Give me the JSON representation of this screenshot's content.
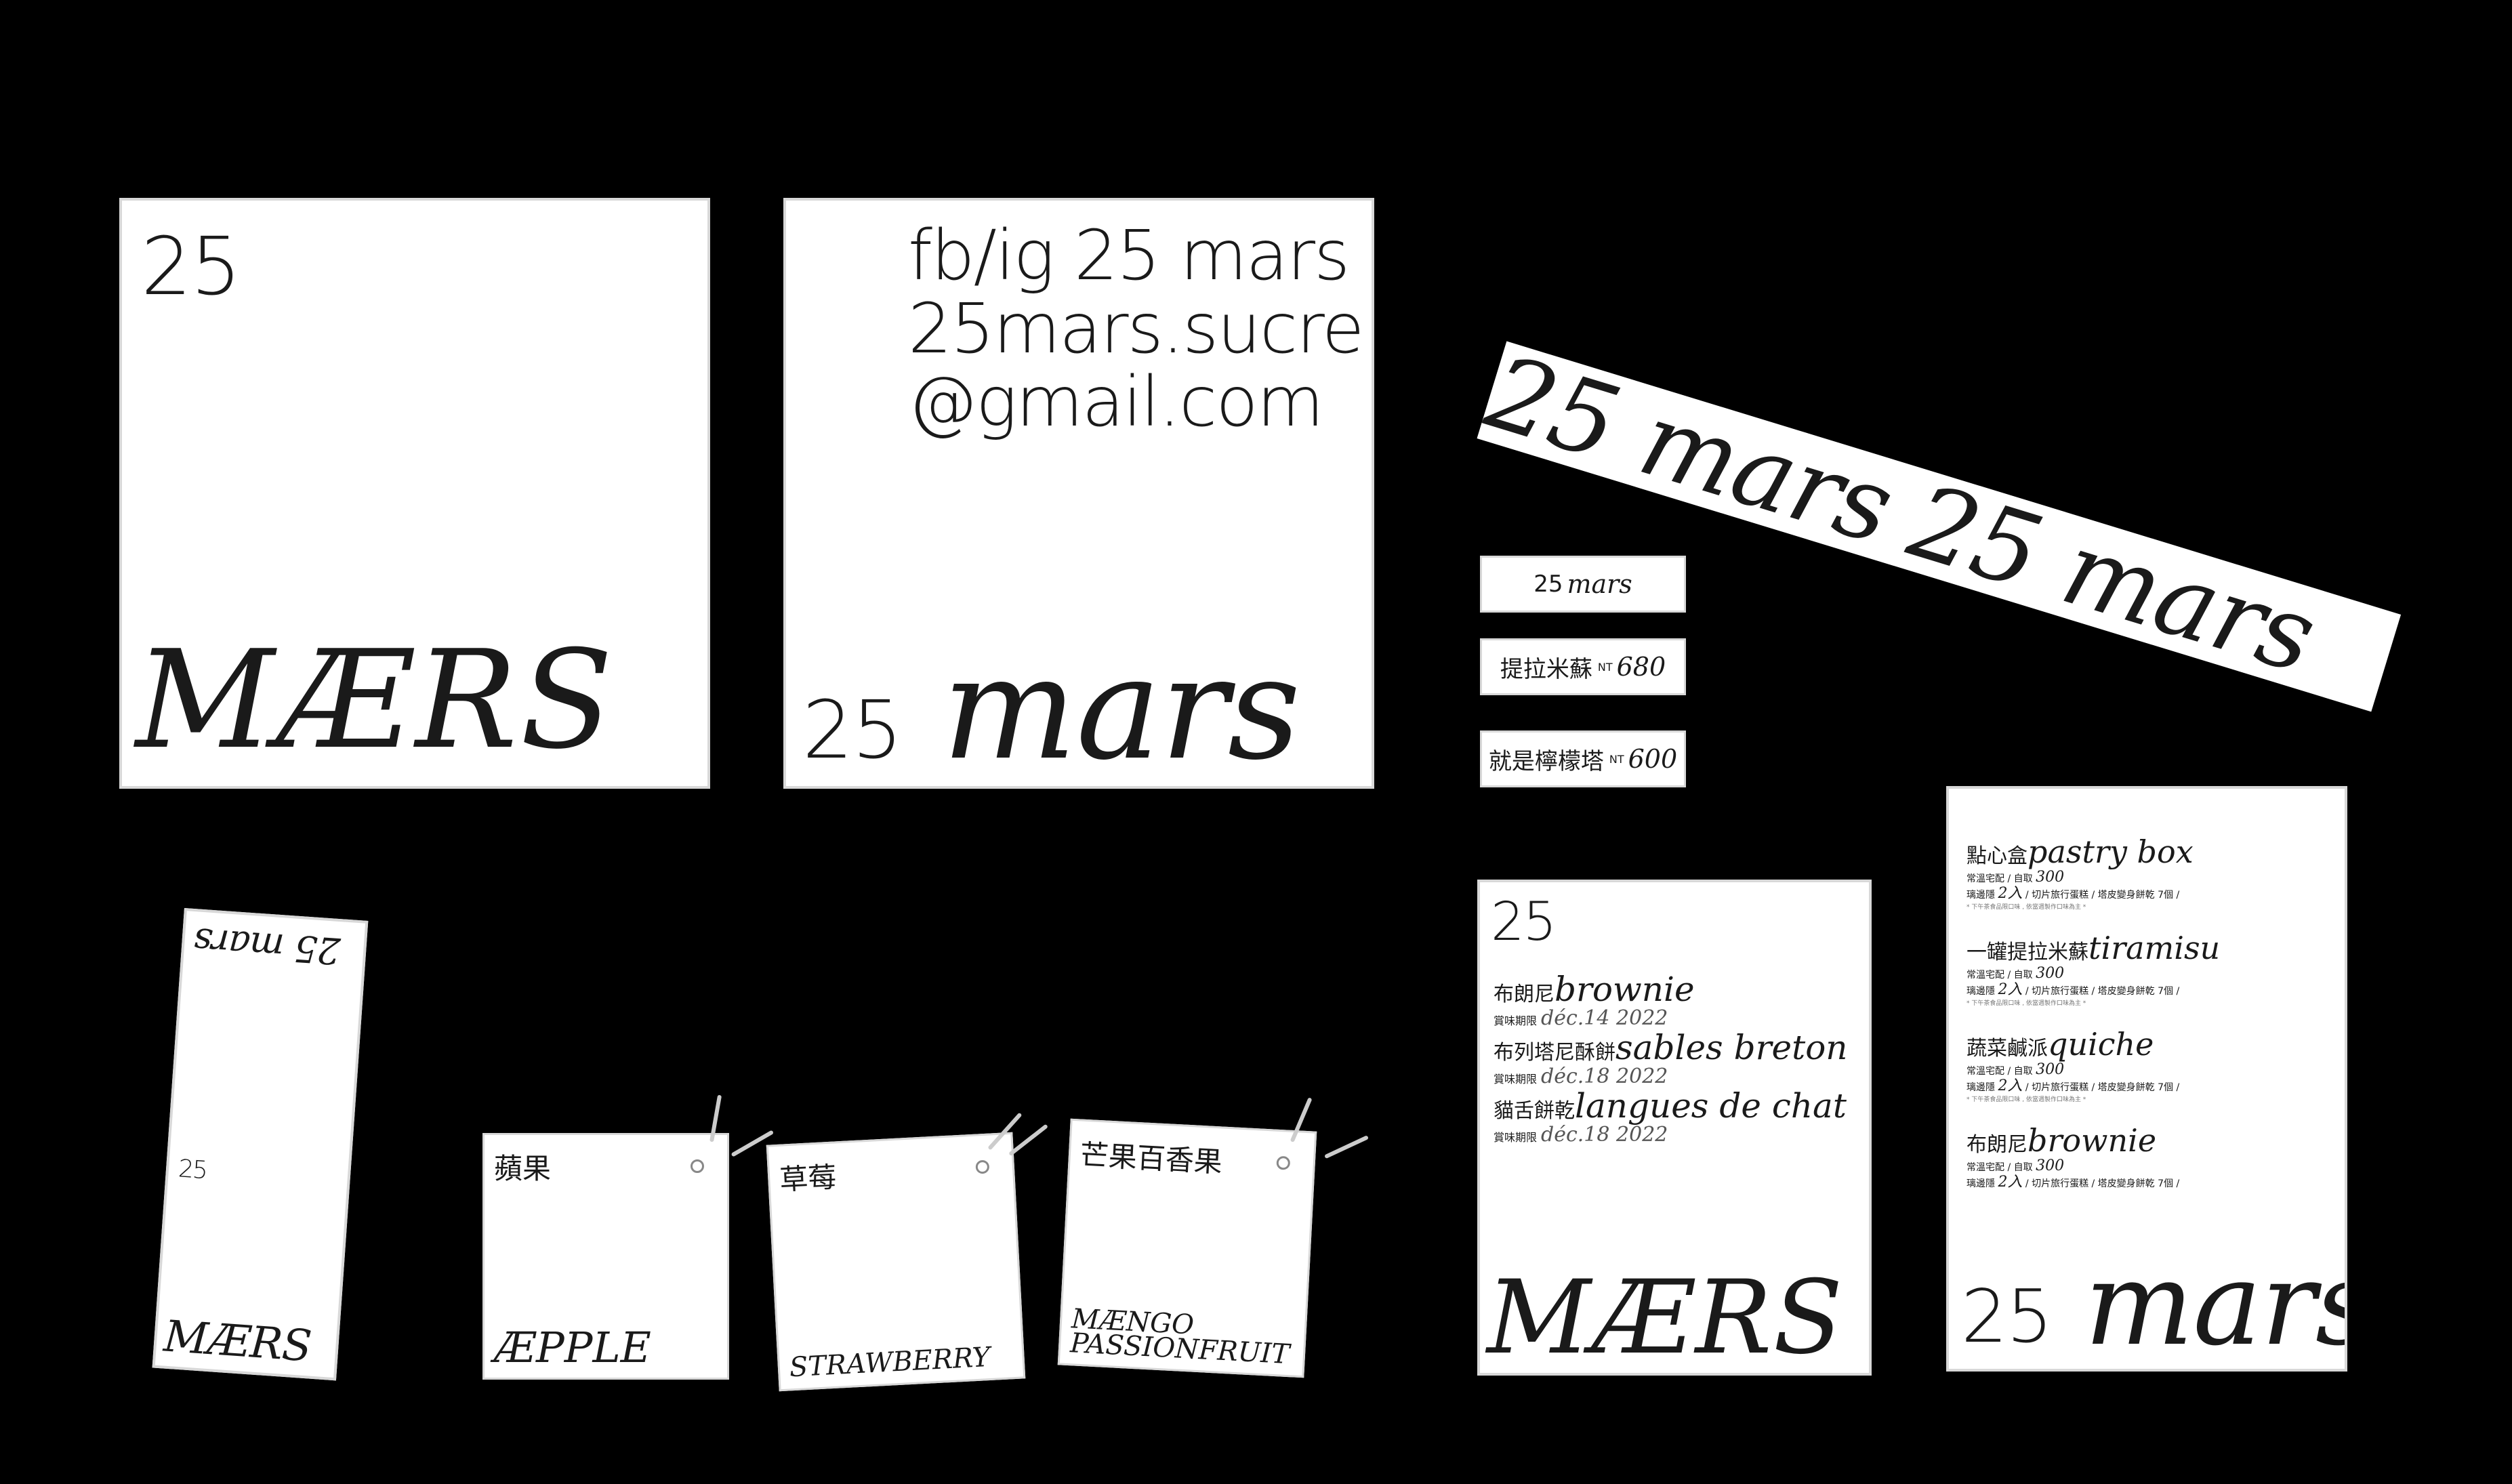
{
  "card_mars_square": {
    "number": "25",
    "word": "MÆRS"
  },
  "card_contact": {
    "line1": "fb/ig  25 mars",
    "line2": "25mars.sucre",
    "line3": "@gmail.com",
    "brand_number": "25",
    "brand_word": "mars"
  },
  "banner": {
    "repeat_1": "25 mars",
    "repeat_2": "25 mars"
  },
  "labels": [
    {
      "zh": "25",
      "en": "mars",
      "price": ""
    },
    {
      "zh": "提拉米蘇",
      "en": "680",
      "price": "NT"
    },
    {
      "zh": "就是檸檬塔",
      "en": "600",
      "price": "NT"
    }
  ],
  "bookmark": {
    "top_word": "25 mars",
    "number": "25",
    "word": "MÆRS"
  },
  "tags": [
    {
      "zh": "蘋果",
      "en": "ÆPPLE"
    },
    {
      "zh": "草莓",
      "en": "STRAWBERRY"
    },
    {
      "zh": "芒果百香果",
      "en_1": "MÆNGO",
      "en_2": "PASSIONFRUIT"
    }
  ],
  "menu_card": {
    "number": "25",
    "items": [
      {
        "zh": "布朗尼",
        "en": "brownie",
        "exp_label": "賞味期限",
        "date": "déc.14 2022"
      },
      {
        "zh": "布列塔尼酥餅",
        "en": "sables breton",
        "exp_label": "賞味期限",
        "date": "déc.18 2022"
      },
      {
        "zh": "貓舌餅乾",
        "en": "langues de chat",
        "exp_label": "賞味期限",
        "date": "déc.18 2022"
      }
    ],
    "word": "MÆRS"
  },
  "pastry_card": {
    "items": [
      {
        "zh": "點心盒",
        "en": "pastry box",
        "line1": "常溫宅配 / 自取 ",
        "price": "300",
        "line2_pre": "璃邊隱 ",
        "line2_sc": "2入",
        "line2_post": " / 切片旅行蛋糕 / 塔皮變身餅乾 ",
        "line2_tail": "7個 /",
        "note": "* 下午茶食品限口味 , 依當週製作口味為主 *"
      },
      {
        "zh": "一罐提拉米蘇",
        "en": "tiramisu",
        "line1": "常溫宅配 / 自取 ",
        "price": "300",
        "line2_pre": "璃邊隱 ",
        "line2_sc": "2入",
        "line2_post": " / 切片旅行蛋糕 / 塔皮變身餅乾 ",
        "line2_tail": "7個 /",
        "note": "* 下午茶食品限口味 , 依當週製作口味為主 *"
      },
      {
        "zh": "蔬菜鹹派",
        "en": "quiche",
        "line1": "常溫宅配 / 自取 ",
        "price": "300",
        "line2_pre": "璃邊隱 ",
        "line2_sc": "2入",
        "line2_post": " / 切片旅行蛋糕 / 塔皮變身餅乾 ",
        "line2_tail": "7個 /",
        "note": "* 下午茶食品限口味 , 依當週製作口味為主 *"
      },
      {
        "zh": "布朗尼",
        "en": "brownie",
        "line1": "常溫宅配 / 自取 ",
        "price": "300",
        "line2_pre": "璃邊隱 ",
        "line2_sc": "2入",
        "line2_post": " / 切片旅行蛋糕 / 塔皮變身餅乾 ",
        "line2_tail": "7個 /",
        "note": ""
      }
    ],
    "brand_number": "25",
    "brand_word": "mars"
  },
  "colors": {
    "background": "#000000",
    "card": "#ffffff",
    "ink": "#1a1a1a"
  }
}
